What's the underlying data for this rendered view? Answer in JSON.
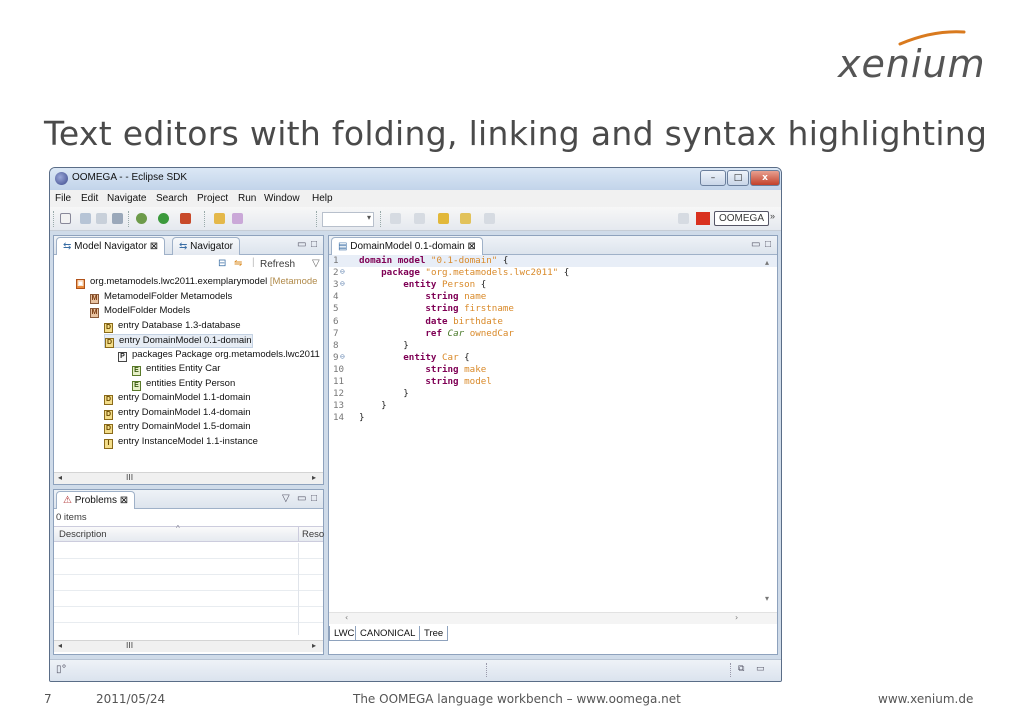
{
  "slide": {
    "logo_text": "xenium",
    "title": "Text editors with folding, linking and syntax highlighting",
    "footer": {
      "page_number": "7",
      "date": "2011/05/24",
      "center": "The OOMEGA language workbench – www.oomega.net",
      "right": "www.xenium.de"
    }
  },
  "window": {
    "title": "OOMEGA -  - Eclipse SDK",
    "controls": {
      "minimize": "–",
      "maximize": "□",
      "close": "x"
    },
    "menu": [
      "File",
      "Edit",
      "Navigate",
      "Search",
      "Project",
      "Run",
      "Window",
      "Help"
    ],
    "perspective_label": "OOMEGA"
  },
  "navigator": {
    "tabs": [
      {
        "label": "Model Navigator",
        "close": "⊠"
      },
      {
        "label": "Navigator"
      }
    ],
    "refresh_label": "Refresh",
    "tree": [
      {
        "icon": "project-icon",
        "label": "org.metamodels.lwc2011.exemplarymodel",
        "suffix": "[Metamode",
        "indent": 0
      },
      {
        "icon": "model-folder-icon",
        "label": "MetamodelFolder Metamodels",
        "indent": 1
      },
      {
        "icon": "model-folder-icon",
        "label": "ModelFolder Models",
        "indent": 1
      },
      {
        "icon": "database-entry-icon",
        "label": "entry Database 1.3-database",
        "indent": 2
      },
      {
        "icon": "domain-entry-icon",
        "label": "entry DomainModel 0.1-domain",
        "indent": 2,
        "selected": true
      },
      {
        "icon": "package-icon",
        "label": "packages Package org.metamodels.lwc2011",
        "indent": 3
      },
      {
        "icon": "entity-icon",
        "label": "entities Entity Car",
        "indent": 4
      },
      {
        "icon": "entity-icon",
        "label": "entities Entity Person",
        "indent": 4
      },
      {
        "icon": "domain-entry-icon",
        "label": "entry DomainModel 1.1-domain",
        "indent": 2
      },
      {
        "icon": "domain-entry-icon",
        "label": "entry DomainModel 1.4-domain",
        "indent": 2
      },
      {
        "icon": "domain-entry-icon",
        "label": "entry DomainModel 1.5-domain",
        "indent": 2
      },
      {
        "icon": "instance-entry-icon",
        "label": "entry InstanceModel 1.1-instance",
        "indent": 2
      }
    ],
    "scroll_thumb": "III"
  },
  "problems": {
    "tab_label": "Problems",
    "close": "⊠",
    "count": "0 items",
    "columns": [
      "Description",
      "Reso"
    ],
    "scroll_thumb": "III"
  },
  "editor": {
    "tab_label": "DomainModel 0.1-domain",
    "close": "⊠",
    "lines": [
      {
        "n": "1",
        "fold": "",
        "tokens": [
          [
            "kw",
            "domain model "
          ],
          [
            "str",
            "\"0.1-domain\""
          ],
          [
            "plain",
            " {"
          ]
        ]
      },
      {
        "n": "2",
        "fold": "⊖",
        "tokens": [
          [
            "plain",
            "    "
          ],
          [
            "kw",
            "package "
          ],
          [
            "str",
            "\"org.metamodels.lwc2011\""
          ],
          [
            "plain",
            " {"
          ]
        ]
      },
      {
        "n": "3",
        "fold": "⊖",
        "tokens": [
          [
            "plain",
            "        "
          ],
          [
            "kw",
            "entity "
          ],
          [
            "str",
            "Person"
          ],
          [
            "plain",
            " {"
          ]
        ]
      },
      {
        "n": "4",
        "fold": "",
        "tokens": [
          [
            "plain",
            "            "
          ],
          [
            "kw",
            "string "
          ],
          [
            "str",
            "name"
          ]
        ]
      },
      {
        "n": "5",
        "fold": "",
        "tokens": [
          [
            "plain",
            "            "
          ],
          [
            "kw",
            "string "
          ],
          [
            "str",
            "firstname"
          ]
        ]
      },
      {
        "n": "6",
        "fold": "",
        "tokens": [
          [
            "plain",
            "            "
          ],
          [
            "kw",
            "date "
          ],
          [
            "str",
            "birthdate"
          ]
        ]
      },
      {
        "n": "7",
        "fold": "",
        "tokens": [
          [
            "plain",
            "            "
          ],
          [
            "kw",
            "ref "
          ],
          [
            "ital",
            "Car"
          ],
          [
            "plain",
            " "
          ],
          [
            "str",
            "ownedCar"
          ]
        ]
      },
      {
        "n": "8",
        "fold": "",
        "tokens": [
          [
            "plain",
            "        }"
          ]
        ]
      },
      {
        "n": "9",
        "fold": "⊖",
        "tokens": [
          [
            "plain",
            "        "
          ],
          [
            "kw",
            "entity "
          ],
          [
            "str",
            "Car"
          ],
          [
            "plain",
            " {"
          ]
        ]
      },
      {
        "n": "10",
        "fold": "",
        "tokens": [
          [
            "plain",
            "            "
          ],
          [
            "kw",
            "string "
          ],
          [
            "str",
            "make"
          ]
        ]
      },
      {
        "n": "11",
        "fold": "",
        "tokens": [
          [
            "plain",
            "            "
          ],
          [
            "kw",
            "string "
          ],
          [
            "str",
            "model"
          ]
        ]
      },
      {
        "n": "12",
        "fold": "",
        "tokens": [
          [
            "plain",
            "        }"
          ]
        ]
      },
      {
        "n": "13",
        "fold": "",
        "tokens": [
          [
            "plain",
            "    }"
          ]
        ]
      },
      {
        "n": "14",
        "fold": "",
        "tokens": [
          [
            "plain",
            "}"
          ]
        ]
      }
    ],
    "bottom_tabs": [
      "LWC",
      "CANONICAL",
      "Tree"
    ]
  },
  "colors": {
    "keyword": "#7f0055",
    "string": "#d98a2a",
    "reference": "#4a7a2a"
  }
}
